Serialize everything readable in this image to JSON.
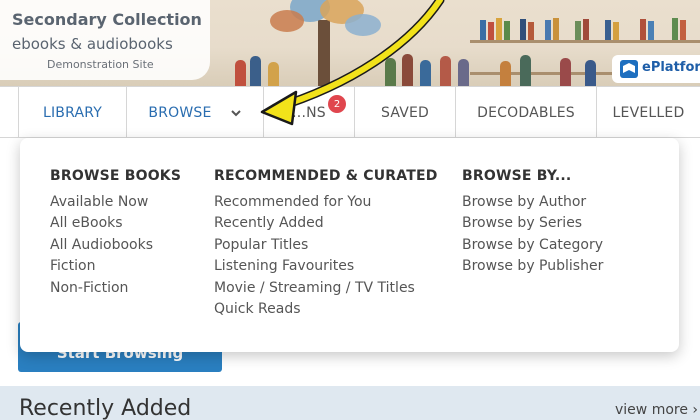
{
  "brand": {
    "title": "Secondary Collection",
    "subtitle": "ebooks & audiobooks",
    "demo_label": "Demonstration Site",
    "platform_name": "ePlatform"
  },
  "nav": {
    "items": [
      {
        "label": "LIBRARY"
      },
      {
        "label": "BROWSE"
      },
      {
        "label": "...NS",
        "badge": "2"
      },
      {
        "label": "SAVED"
      },
      {
        "label": "DECODABLES"
      },
      {
        "label": "LEVELLED"
      }
    ]
  },
  "dropdown": {
    "columns": [
      {
        "heading": "BROWSE BOOKS",
        "links": [
          "Available Now",
          "All eBooks",
          "All Audiobooks",
          "Fiction",
          "Non-Fiction"
        ]
      },
      {
        "heading": "RECOMMENDED & CURATED",
        "links": [
          "Recommended for You",
          "Recently Added",
          "Popular Titles",
          "Listening Favourites",
          "Movie / Streaming / TV Titles",
          "Quick Reads"
        ]
      },
      {
        "heading": "BROWSE BY...",
        "links": [
          "Browse by Author",
          "Browse by Series",
          "Browse by Category",
          "Browse by Publisher"
        ]
      }
    ]
  },
  "page": {
    "start_button": "Start Browsing",
    "section_title": "Recently Added",
    "view_more": "view more ›"
  },
  "colors": {
    "accent_blue": "#2a6db0",
    "badge_red": "#e0464e",
    "arrow_yellow": "#f2e21a",
    "button_blue": "#2a7fc0"
  },
  "icons": {
    "browse_toggle": "chevron-down-icon",
    "platform_logo": "eplatform-logo-icon",
    "annotation": "pointer-arrow-icon"
  }
}
